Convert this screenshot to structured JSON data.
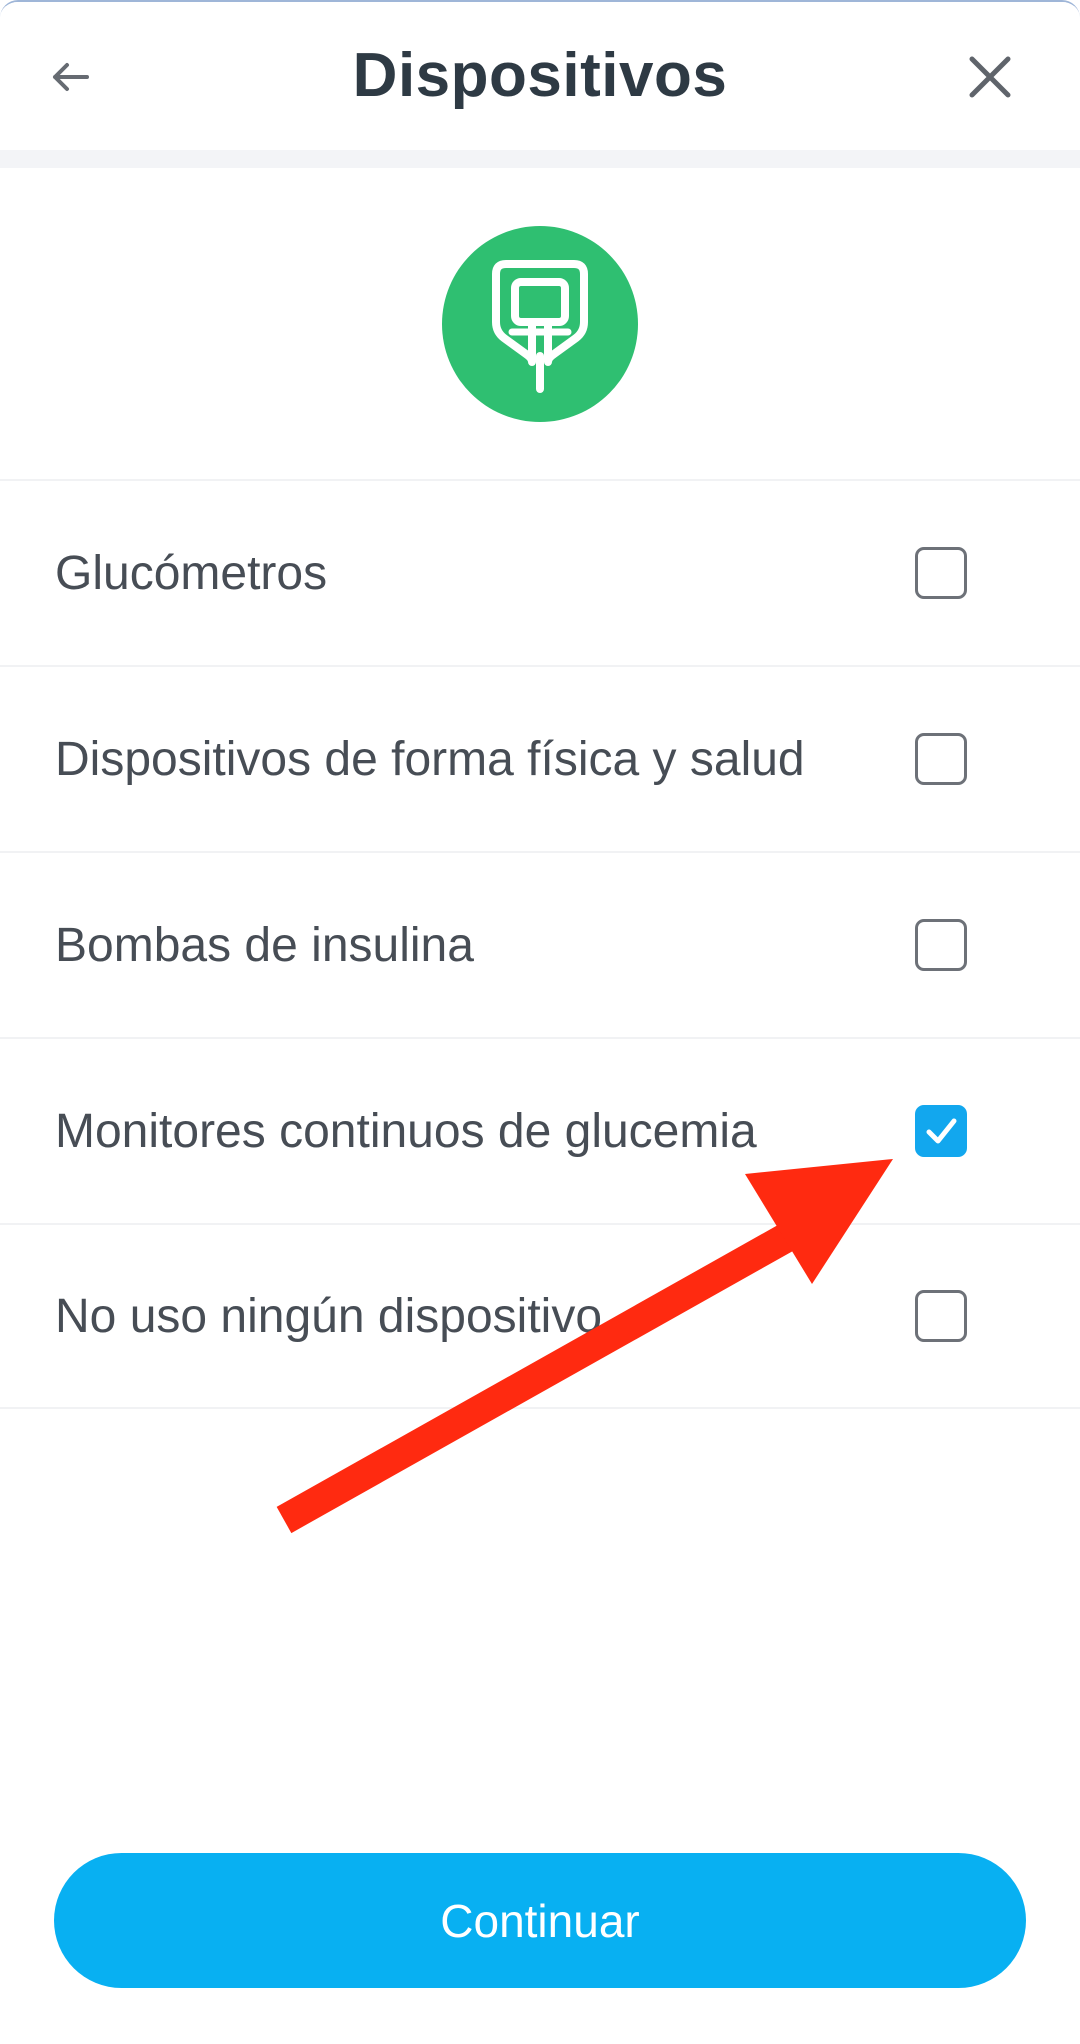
{
  "header": {
    "title": "Dispositivos",
    "back_icon": "back-arrow-icon",
    "close_icon": "close-icon"
  },
  "hero": {
    "icon": "glucometer-icon",
    "color": "#2fbf71"
  },
  "options": [
    {
      "label": "Glucómetros",
      "checked": false
    },
    {
      "label": "Dispositivos de forma física y salud",
      "checked": false
    },
    {
      "label": "Bombas de insulina",
      "checked": false
    },
    {
      "label": "Monitores continuos de glucemia",
      "checked": true
    },
    {
      "label": "No uso ningún dispositivo",
      "checked": false
    }
  ],
  "annotation": {
    "type": "red-arrow",
    "color": "#ff2a10"
  },
  "footer": {
    "continue_label": "Continuar"
  },
  "colors": {
    "accent": "#12a7ee",
    "button": "#08b0f2",
    "title": "#2e3a44",
    "text": "#474d55"
  }
}
